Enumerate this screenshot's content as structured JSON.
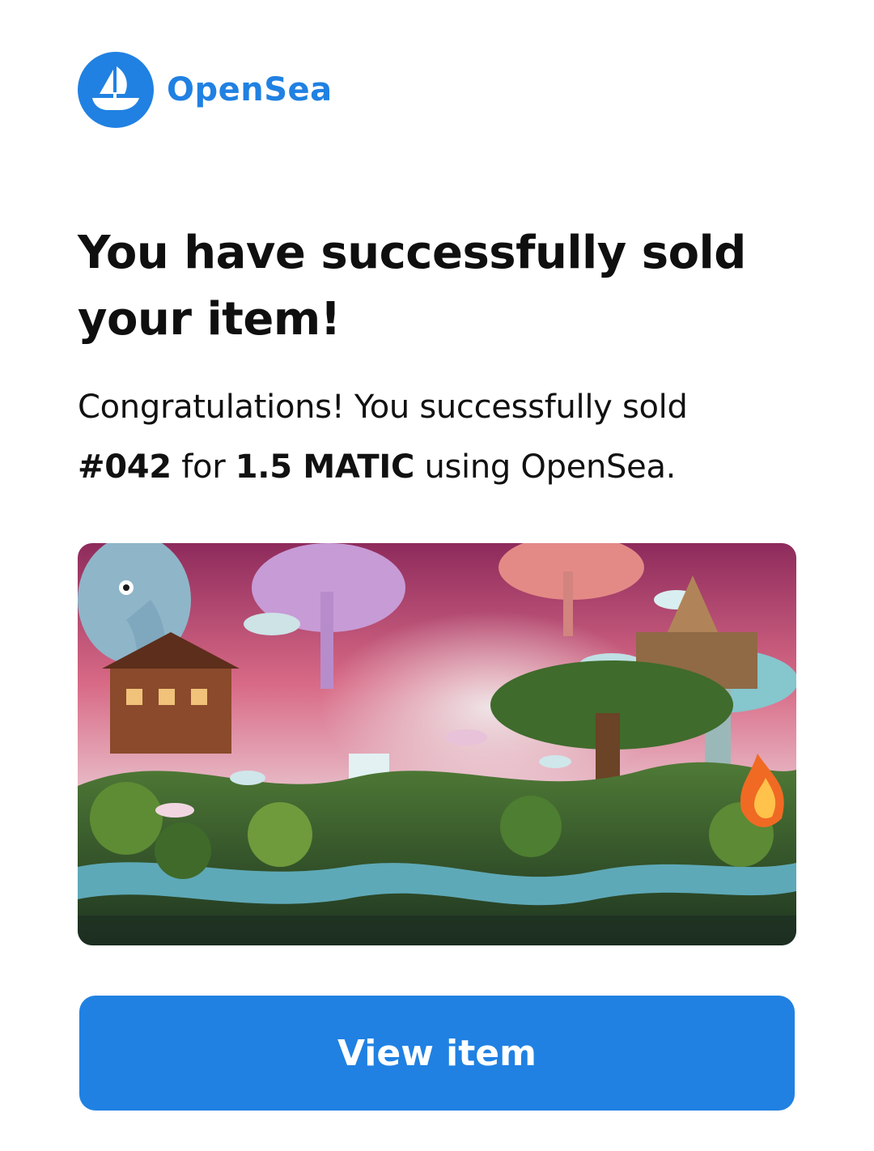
{
  "brand": {
    "name": "OpenSea",
    "logo_icon": "opensea-ship-icon",
    "color": "#2081e2"
  },
  "headline": "You have successfully sold your item!",
  "message": {
    "lead": "Congratulations! You successfully sold",
    "item": "#042",
    "for_text": "for",
    "price": "1.5 MATIC",
    "tail": "using OpenSea."
  },
  "nft": {
    "icon": "fantasy-landscape-artwork"
  },
  "button": {
    "label": "View item",
    "color": "#2081e2"
  }
}
